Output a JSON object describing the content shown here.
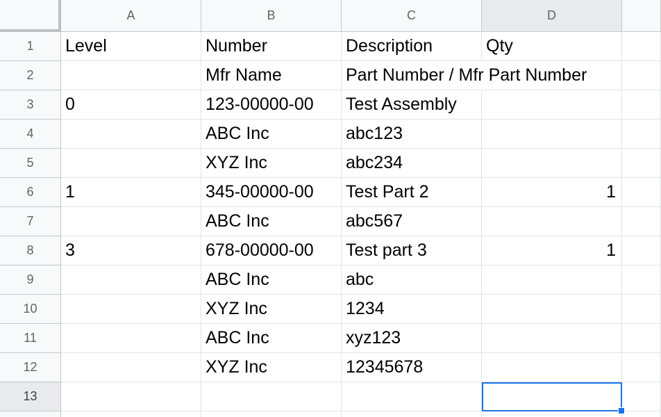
{
  "columns": [
    "A",
    "B",
    "C",
    "D"
  ],
  "rows": [
    {
      "num": "1",
      "A": "Level",
      "B": "Number",
      "C": "Description",
      "D": "Qty"
    },
    {
      "num": "2",
      "A": "",
      "B": "Mfr Name",
      "C": "Part Number / Mfr Part Number",
      "D": ""
    },
    {
      "num": "3",
      "A": "0",
      "B": "123-00000-00",
      "C": "Test Assembly",
      "D": ""
    },
    {
      "num": "4",
      "A": "",
      "B": "ABC Inc",
      "C": "abc123",
      "D": ""
    },
    {
      "num": "5",
      "A": "",
      "B": "XYZ Inc",
      "C": "abc234",
      "D": ""
    },
    {
      "num": "6",
      "A": "1",
      "B": "345-00000-00",
      "C": "Test Part 2",
      "D": "1"
    },
    {
      "num": "7",
      "A": "",
      "B": "ABC Inc",
      "C": "abc567",
      "D": ""
    },
    {
      "num": "8",
      "A": "3",
      "B": "678-00000-00",
      "C": "Test part 3",
      "D": "1"
    },
    {
      "num": "9",
      "A": "",
      "B": "ABC Inc",
      "C": "abc",
      "D": ""
    },
    {
      "num": "10",
      "A": "",
      "B": "XYZ Inc",
      "C": "1234",
      "D": ""
    },
    {
      "num": "11",
      "A": "",
      "B": "ABC Inc",
      "C": "xyz123",
      "D": ""
    },
    {
      "num": "12",
      "A": "",
      "B": "XYZ Inc",
      "C": "12345678",
      "D": ""
    },
    {
      "num": "13",
      "A": "",
      "B": "",
      "C": "",
      "D": ""
    }
  ],
  "selection": {
    "cell": "D13",
    "color": "#1a73e8"
  },
  "colors": {
    "header_bg": "#f8f9fa",
    "active_header_bg": "#e8eaed",
    "gridline": "#e2e3e3",
    "header_text": "#5f6368"
  }
}
